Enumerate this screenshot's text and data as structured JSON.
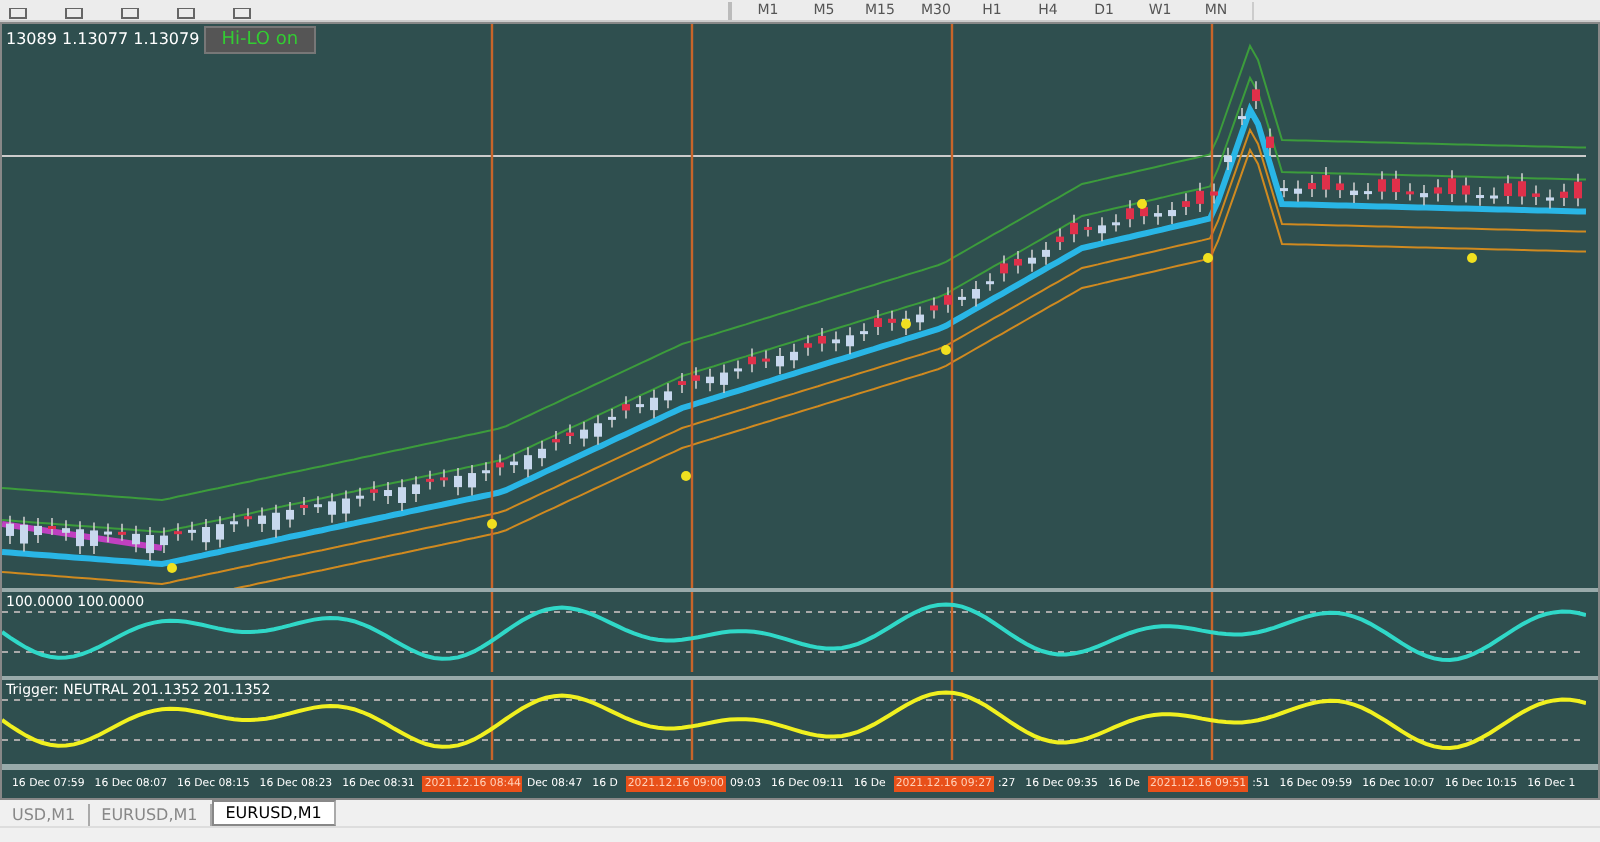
{
  "toolbar": {
    "timeframes": [
      "M1",
      "M5",
      "M15",
      "M30",
      "H1",
      "H4",
      "D1",
      "W1",
      "MN"
    ]
  },
  "main_chart": {
    "price_info": "13089 1.13077 1.13079",
    "hilo_button": "Hi-LO on"
  },
  "oscillator": {
    "label": "100.0000 100.0000"
  },
  "trigger": {
    "label": "Trigger: NEUTRAL 201.1352 201.1352"
  },
  "time_axis": [
    {
      "kind": "tick",
      "text": "16 Dec 07:59"
    },
    {
      "kind": "tick",
      "text": "16 Dec 08:07"
    },
    {
      "kind": "tick",
      "text": "16 Dec 08:15"
    },
    {
      "kind": "tick",
      "text": "16 Dec 08:23"
    },
    {
      "kind": "tick",
      "text": "16 Dec 08:31"
    },
    {
      "kind": "marker",
      "text": "2021.12.16 08:44"
    },
    {
      "kind": "tick",
      "text": "Dec 08:47"
    },
    {
      "kind": "tick",
      "text": "16 D"
    },
    {
      "kind": "marker",
      "text": "2021.12.16 09:00"
    },
    {
      "kind": "tick",
      "text": "09:03"
    },
    {
      "kind": "tick",
      "text": "16 Dec 09:11"
    },
    {
      "kind": "tick",
      "text": "16 De"
    },
    {
      "kind": "marker",
      "text": "2021.12.16 09:27"
    },
    {
      "kind": "tick",
      "text": ":27"
    },
    {
      "kind": "tick",
      "text": "16 Dec 09:35"
    },
    {
      "kind": "tick",
      "text": "16 De"
    },
    {
      "kind": "marker",
      "text": "2021.12.16 09:51"
    },
    {
      "kind": "tick",
      "text": ":51"
    },
    {
      "kind": "tick",
      "text": "16 Dec 09:59"
    },
    {
      "kind": "tick",
      "text": "16 Dec 10:07"
    },
    {
      "kind": "tick",
      "text": "16 Dec 10:15"
    },
    {
      "kind": "tick",
      "text": "16 Dec 1"
    }
  ],
  "tabs": [
    {
      "label": "USD,M1",
      "selected": false
    },
    {
      "label": "EURUSD,M1",
      "selected": false
    },
    {
      "label": "EURUSD,M1",
      "selected": true
    }
  ]
}
